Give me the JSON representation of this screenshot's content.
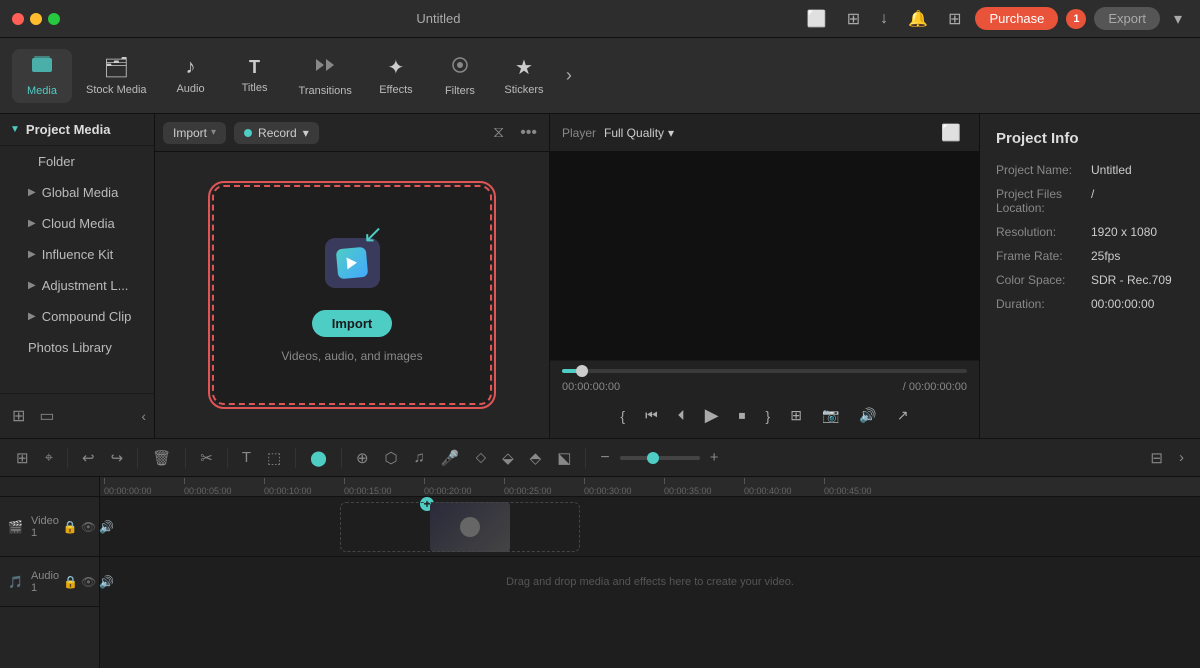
{
  "titleBar": {
    "title": "Untitled",
    "purchaseLabel": "Purchase",
    "exportLabel": "Export",
    "notificationCount": "1"
  },
  "toolbar": {
    "items": [
      {
        "id": "media",
        "label": "Media",
        "icon": "⬛",
        "active": true
      },
      {
        "id": "stock-media",
        "label": "Stock Media",
        "icon": "🗂"
      },
      {
        "id": "audio",
        "label": "Audio",
        "icon": "♪"
      },
      {
        "id": "titles",
        "label": "Titles",
        "icon": "T"
      },
      {
        "id": "transitions",
        "label": "Transitions",
        "icon": "↔"
      },
      {
        "id": "effects",
        "label": "Effects",
        "icon": "✦"
      },
      {
        "id": "filters",
        "label": "Filters",
        "icon": "◈"
      },
      {
        "id": "stickers",
        "label": "Stickers",
        "icon": "★"
      }
    ],
    "moreIcon": "›"
  },
  "leftPanel": {
    "projectMedia": "Project Media",
    "folder": "Folder",
    "globalMedia": "Global Media",
    "cloudMedia": "Cloud Media",
    "influenceKit": "Influence Kit",
    "adjustmentL": "Adjustment L...",
    "compoundClip": "Compound Clip",
    "photosLibrary": "Photos Library"
  },
  "mediaPanel": {
    "importLabel": "Import",
    "recordLabel": "Record",
    "dropZone": {
      "importBtnLabel": "Import",
      "subtitle": "Videos, audio, and images"
    }
  },
  "playerPanel": {
    "playerLabel": "Player",
    "qualityLabel": "Full Quality",
    "currentTime": "00:00:00:00",
    "totalTime": "/ 00:00:00:00"
  },
  "rightPanel": {
    "title": "Project Info",
    "fields": [
      {
        "label": "Project Name:",
        "value": "Untitled"
      },
      {
        "label": "Project Files Location:",
        "value": "/"
      },
      {
        "label": "Resolution:",
        "value": "1920 x 1080"
      },
      {
        "label": "Frame Rate:",
        "value": "25fps"
      },
      {
        "label": "Color Space:",
        "value": "SDR - Rec.709"
      },
      {
        "label": "Duration:",
        "value": "00:00:00:00"
      }
    ]
  },
  "timeline": {
    "rulerMarks": [
      "00:00:00:00",
      "00:00:05:00",
      "00:00:10:00",
      "00:00:15:00",
      "00:00:20:00",
      "00:00:25:00",
      "00:00:30:00",
      "00:00:35:00",
      "00:00:40:00",
      "00:00:45:00"
    ],
    "tracks": [
      {
        "id": "video1",
        "label": "Video 1",
        "type": "video"
      },
      {
        "id": "audio1",
        "label": "Audio 1",
        "type": "audio"
      }
    ],
    "dropHint": "Drag and drop media and effects here to create your video."
  }
}
